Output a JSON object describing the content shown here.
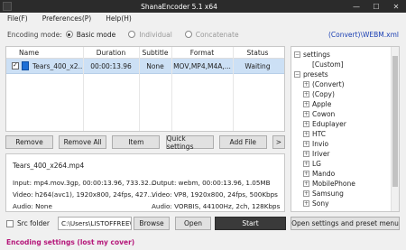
{
  "window": {
    "title": "ShanaEncoder 5.1 x64",
    "minimize": "—",
    "maximize": "☐",
    "close": "✕"
  },
  "menu": [
    "File(F)",
    "Preferences(P)",
    "Help(H)"
  ],
  "mode": {
    "label": "Encoding mode:",
    "options": [
      {
        "label": "Basic mode",
        "selected": true
      },
      {
        "label": "Individual",
        "selected": false
      },
      {
        "label": "Concatenate",
        "selected": false
      }
    ],
    "preset_path": "(Convert)\\WEBM.xml"
  },
  "filelist": {
    "columns": [
      "Name",
      "Duration",
      "Subtitle",
      "Format",
      "Status"
    ],
    "rows": [
      {
        "name": "Tears_400_x2...",
        "duration": "00:00:13.96",
        "subtitle": "None",
        "format": "MOV,MP4,M4A,...",
        "status": "Waiting",
        "checked": true
      }
    ]
  },
  "buttons": {
    "remove": "Remove",
    "remove_all": "Remove All",
    "item": "Item",
    "quick_settings": "Quick settings",
    "add_file": "Add File",
    "more": ">"
  },
  "info": {
    "filename": "Tears_400_x264.mp4",
    "input": "Input: mp4.mov.3gp, 00:00:13.96, 733.32...",
    "input_video": "Video: h264(avc1), 1920x800, 24fps, 427...",
    "input_audio": "Audio: None",
    "output": "Output: webm, 00:00:13.96, 1.05MB",
    "output_video": "Video: VP8, 1920x800, 24fps, 500Kbps",
    "output_audio": "Audio: VORBIS, 44100Hz, 2ch, 128Kbps"
  },
  "tree": [
    {
      "label": "settings",
      "level": 0,
      "toggle": "−"
    },
    {
      "label": "[Custom]",
      "level": 1,
      "toggle": ""
    },
    {
      "label": "presets",
      "level": 0,
      "toggle": "−"
    },
    {
      "label": "(Convert)",
      "level": 1,
      "toggle": "+"
    },
    {
      "label": "(Copy)",
      "level": 1,
      "toggle": "+"
    },
    {
      "label": "Apple",
      "level": 1,
      "toggle": "+"
    },
    {
      "label": "Cowon",
      "level": 1,
      "toggle": "+"
    },
    {
      "label": "Eduplayer",
      "level": 1,
      "toggle": "+"
    },
    {
      "label": "HTC",
      "level": 1,
      "toggle": "+"
    },
    {
      "label": "Invio",
      "level": 1,
      "toggle": "+"
    },
    {
      "label": "Iriver",
      "level": 1,
      "toggle": "+"
    },
    {
      "label": "LG",
      "level": 1,
      "toggle": "+"
    },
    {
      "label": "Mando",
      "level": 1,
      "toggle": "+"
    },
    {
      "label": "MobilePhone",
      "level": 1,
      "toggle": "+"
    },
    {
      "label": "Samsung",
      "level": 1,
      "toggle": "+"
    },
    {
      "label": "Sony",
      "level": 1,
      "toggle": "+"
    }
  ],
  "bottom": {
    "src_folder": "Src folder",
    "path": "C:\\Users\\LISTOFFREE\\",
    "browse": "Browse",
    "open": "Open",
    "start": "Start",
    "open_settings": "Open settings and preset menu"
  },
  "status_text": "Encoding settings (lost my cover)"
}
